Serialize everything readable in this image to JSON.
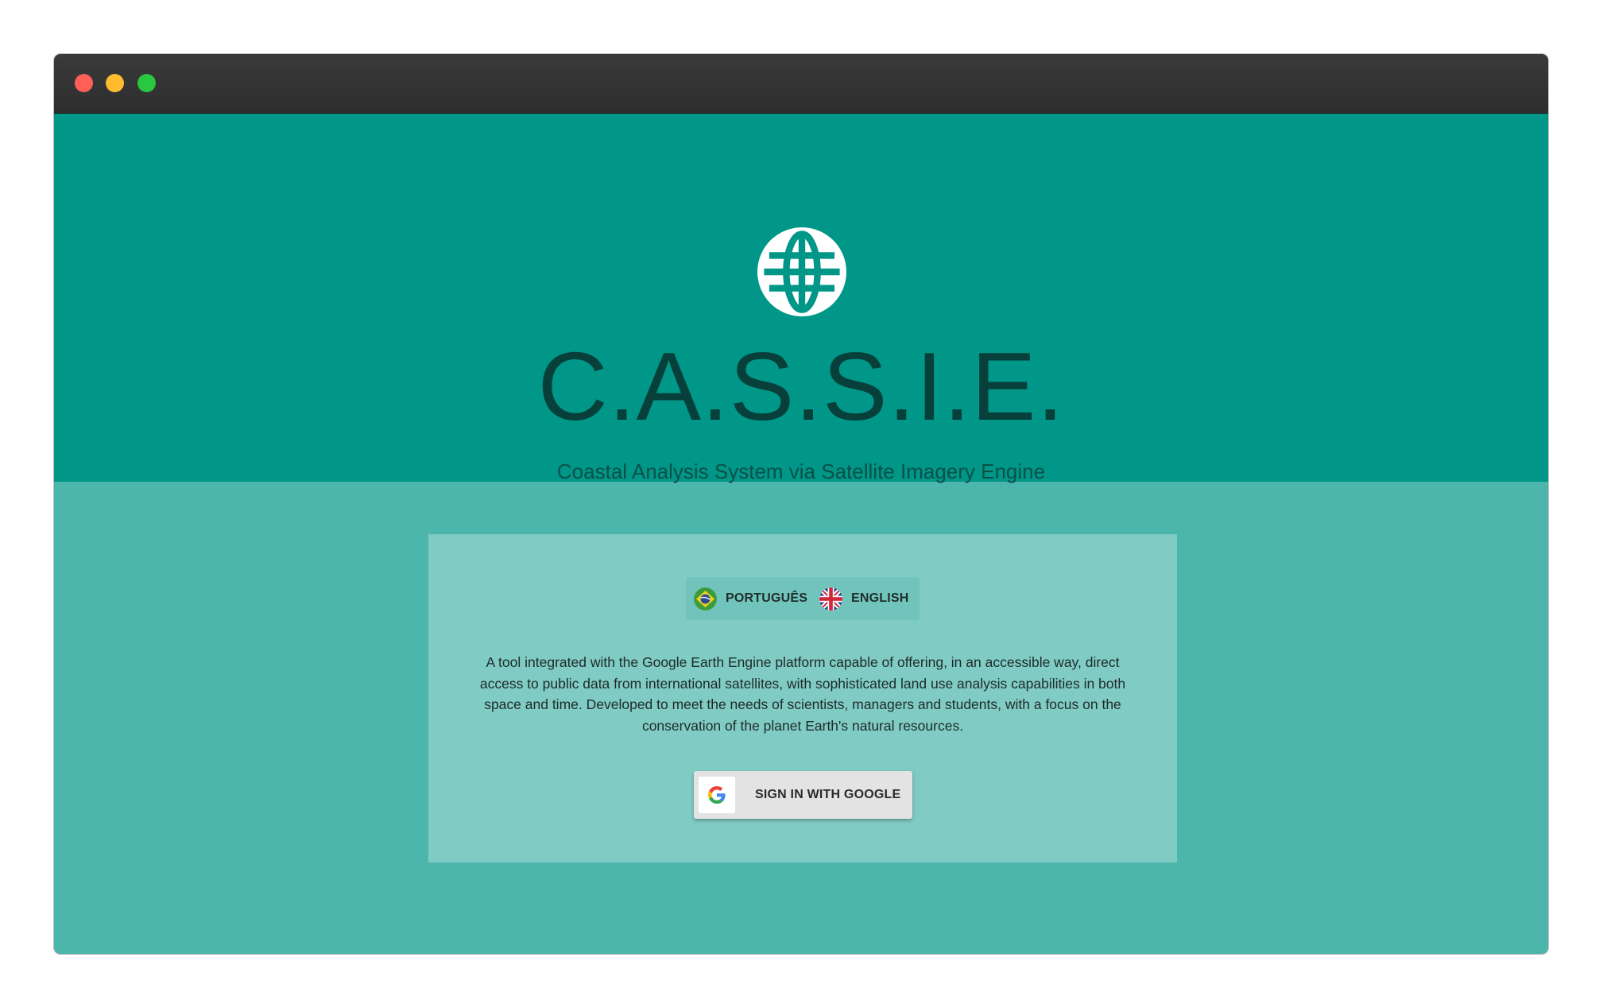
{
  "app": {
    "title": "C.A.S.S.I.E.",
    "subtitle": "Coastal Analysis System via Satellite Imagery Engine",
    "logo_icon": "globe-icon"
  },
  "languages": [
    {
      "label": "PORTUGUÊS",
      "icon": "brazil-flag-icon"
    },
    {
      "label": "ENGLISH",
      "icon": "uk-flag-icon"
    }
  ],
  "description": "A tool integrated with the Google Earth Engine platform capable of offering, in an accessible way, direct access to public data from international satellites, with sophisticated land use analysis capabilities in both space and time. Developed to meet the needs of scientists, managers and students, with a focus on the conservation of the planet Earth's natural resources.",
  "signin": {
    "label": "SIGN IN WITH GOOGLE",
    "icon": "google-icon"
  },
  "colors": {
    "hero": "#009688",
    "background": "#4db6ac",
    "card": "#80cbc4"
  }
}
